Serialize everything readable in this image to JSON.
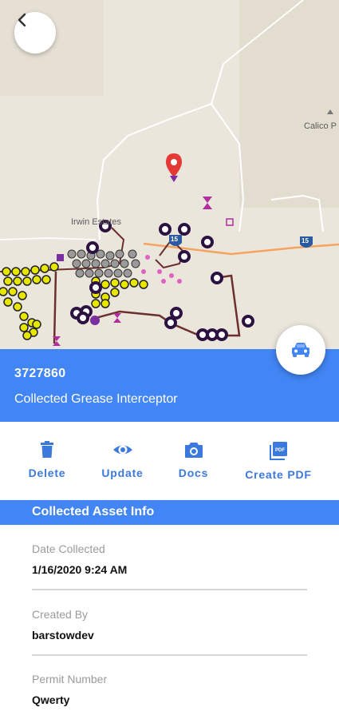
{
  "map": {
    "labels": {
      "irwin": "Irwin Estates",
      "calico": "Calico P",
      "shield_15a": "15",
      "shield_15b": "15"
    }
  },
  "icons": {
    "back": "chevron-left-icon",
    "car": "car-icon",
    "pin": "map-pin-icon"
  },
  "asset": {
    "id": "3727860",
    "type": "Collected Grease Interceptor"
  },
  "actions": [
    {
      "label": "Delete",
      "icon": "trash-icon"
    },
    {
      "label": "Update",
      "icon": "eye-icon"
    },
    {
      "label": "Docs",
      "icon": "camera-icon"
    },
    {
      "label": "Create PDF",
      "icon": "pdf-icon"
    }
  ],
  "section": {
    "title": "Collected Asset Info"
  },
  "fields": [
    {
      "label": "Date Collected",
      "value": "1/16/2020 9:24 AM"
    },
    {
      "label": "Created By",
      "value": "barstowdev"
    },
    {
      "label": "Permit Number",
      "value": "Qwerty"
    }
  ],
  "colors": {
    "primary": "#4285f4",
    "action_text": "#3b79dd",
    "map_bg": "#ebe6dc",
    "marker_dark": "#2b1240",
    "marker_yellow": "#e6e600",
    "line_brown": "#6b2f2f",
    "pin_red": "#e53935"
  }
}
